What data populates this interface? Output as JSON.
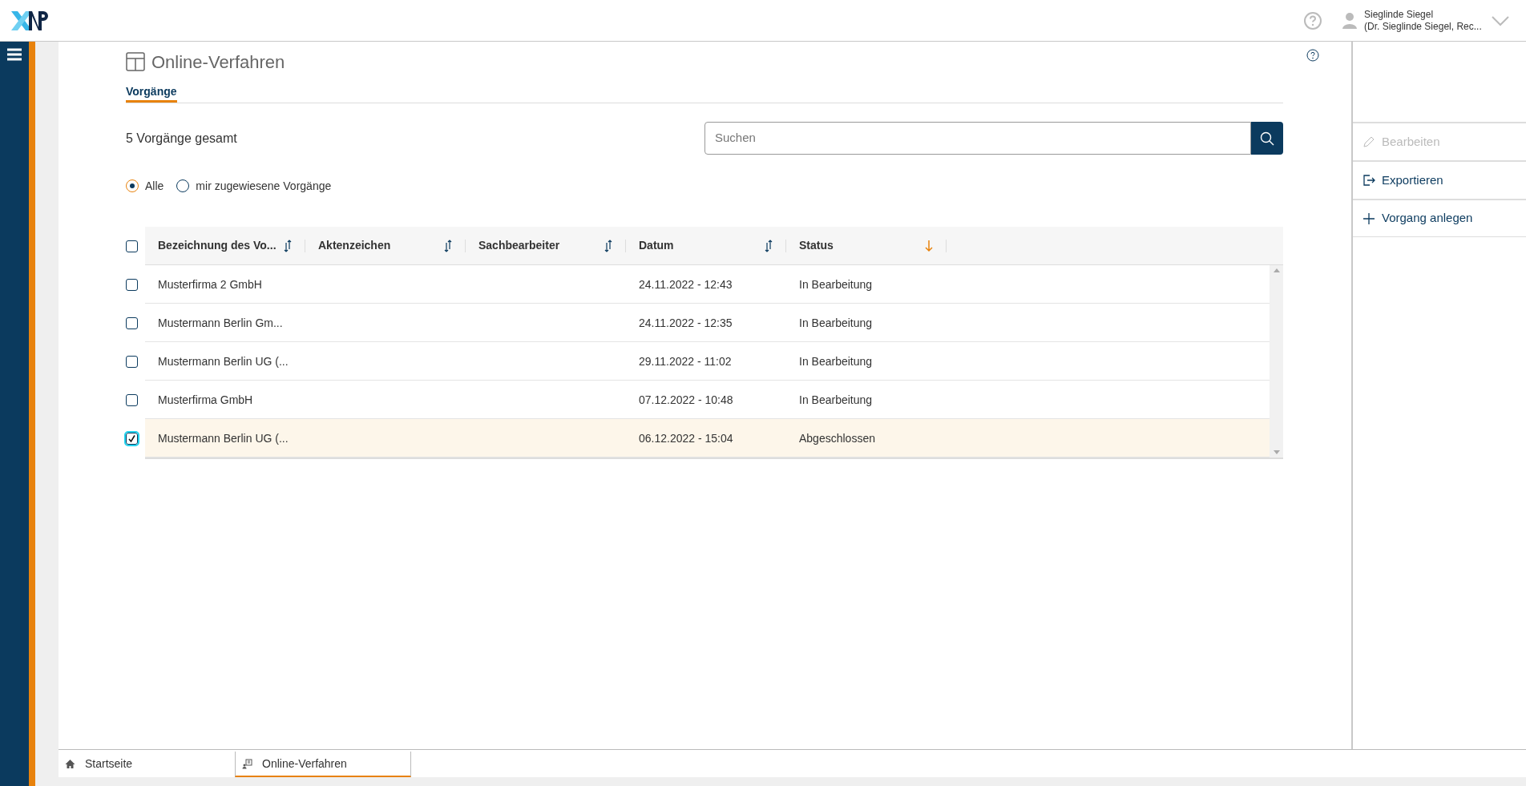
{
  "header": {
    "user_name": "Sieglinde Siegel",
    "user_detail": "(Dr. Sieglinde Siegel, Rec..."
  },
  "page": {
    "title": "Online-Verfahren",
    "tabs": [
      {
        "label": "Vorgänge",
        "selected": true
      }
    ],
    "count": "5 Vorgänge gesamt",
    "search": {
      "placeholder": "Suchen"
    },
    "filters": [
      {
        "label": "Alle",
        "selected": true
      },
      {
        "label": "mir zugewiesene Vorgänge",
        "selected": false
      }
    ]
  },
  "table": {
    "all_checked": false,
    "columns": [
      {
        "label": "Bezeichnung des Vo...",
        "sorted": false
      },
      {
        "label": "Aktenzeichen",
        "sorted": false
      },
      {
        "label": "Sachbearbeiter",
        "sorted": false
      },
      {
        "label": "Datum",
        "sorted": false
      },
      {
        "label": "Status",
        "sorted": true
      }
    ],
    "rows": [
      {
        "checked": false,
        "cells": [
          "Musterfirma 2 GmbH",
          "",
          "",
          "24.11.2022 - 12:43",
          "In Bearbeitung"
        ]
      },
      {
        "checked": false,
        "cells": [
          "Mustermann Berlin Gm...",
          "",
          "",
          "24.11.2022 - 12:35",
          "In Bearbeitung"
        ]
      },
      {
        "checked": false,
        "cells": [
          "Mustermann Berlin UG (...",
          "",
          "",
          "29.11.2022 - 11:02",
          "In Bearbeitung"
        ]
      },
      {
        "checked": false,
        "cells": [
          "Musterfirma GmbH",
          "",
          "",
          "07.12.2022 - 10:48",
          "In Bearbeitung"
        ]
      },
      {
        "checked": true,
        "cells": [
          "Mustermann Berlin UG (...",
          "",
          "",
          "06.12.2022 - 15:04",
          "Abgeschlossen"
        ]
      }
    ]
  },
  "actions": [
    {
      "kind": "edit",
      "label": "Bearbeiten",
      "disabled": true
    },
    {
      "kind": "export",
      "label": "Exportieren",
      "disabled": false
    },
    {
      "kind": "add",
      "label": "Vorgang anlegen",
      "disabled": false
    }
  ],
  "bottom_tabs": [
    {
      "kind": "home",
      "label": "Startseite",
      "selected": false
    },
    {
      "kind": "procedure",
      "label": "Online-Verfahren",
      "selected": true
    }
  ]
}
